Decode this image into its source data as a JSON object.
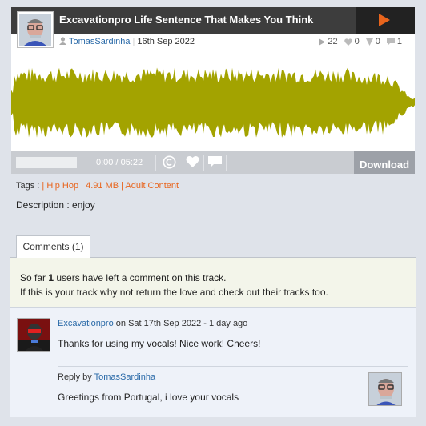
{
  "track": {
    "title": "Excavationpro Life Sentence That Makes You Think",
    "author": "TomasSardinha",
    "date": "16th Sep 2022",
    "plays": "22",
    "likes": "0",
    "downloads": "0",
    "comments_count": "1"
  },
  "player": {
    "time": "0:00 / 05:22",
    "download_label": "Download",
    "icons": [
      "play-icon",
      "copyright-icon",
      "heart-icon",
      "comment-icon"
    ],
    "waveform_color": "#a3a300"
  },
  "tags": {
    "prefix": "Tags :",
    "items": [
      "Hip Hop",
      "4.91 MB",
      "Adult Content"
    ]
  },
  "description": "Description : enjoy",
  "comments_tab": {
    "label": "Comments (1)"
  },
  "comments_panel": {
    "line1_before": "So far ",
    "count": "1",
    "line1_after": " users have left a comment on this track.",
    "line2": "If this is your track why not return the love and check out their tracks too."
  },
  "comment": {
    "author": "Excavationpro",
    "date_text": " on Sat 17th Sep 2022 - 1 day ago",
    "text": "Thanks for using my vocals! Nice work! Cheers!"
  },
  "reply": {
    "prefix": "Reply by ",
    "author": "TomasSardinha",
    "text": "Greetings from Portugal, i love your vocals"
  },
  "colors": {
    "accent": "#e8641c",
    "link": "#2a6aa8",
    "titlebar": "#3d3d3d",
    "waveform": "#a3a300"
  }
}
